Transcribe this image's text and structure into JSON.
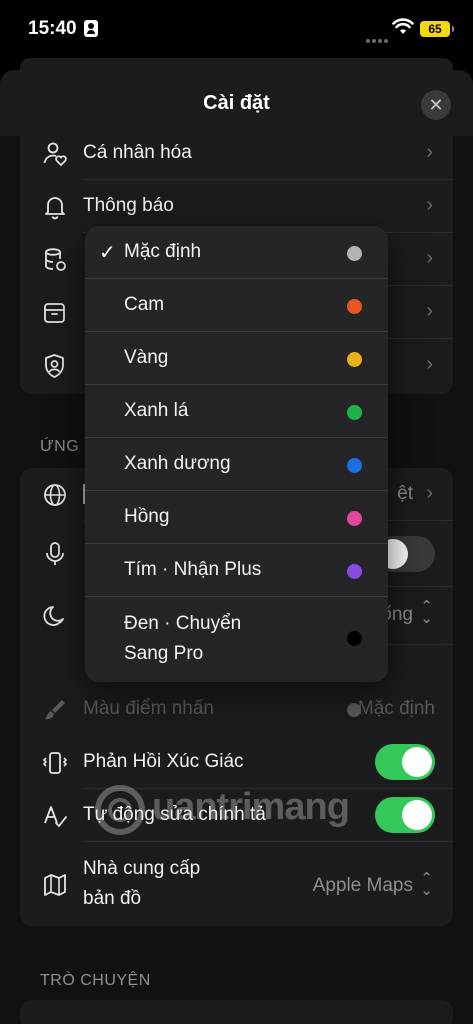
{
  "status_bar": {
    "time": "15:40",
    "battery": "65"
  },
  "sheet": {
    "title": "Cài đặt",
    "close_label": "✕"
  },
  "top_group": [
    {
      "label": "Cá nhân hóa",
      "icon": "person-heart-icon"
    },
    {
      "label": "Thông báo",
      "icon": "bell-icon"
    },
    {
      "label": "",
      "icon": "database-icon"
    },
    {
      "label": "",
      "icon": "archive-icon"
    },
    {
      "label": "",
      "icon": "shield-person-icon"
    }
  ],
  "section_app": {
    "header": "ỨNG"
  },
  "app_group": {
    "language": {
      "icon": "globe-icon",
      "value": "ệt"
    },
    "voice": {
      "icon": "microphone-icon"
    },
    "appearance": {
      "icon": "moon-icon",
      "value": "ống"
    },
    "accent_color": {
      "icon": "brush-icon",
      "label": "Màu điểm nhấn",
      "value": "Mặc định"
    },
    "haptic": {
      "icon": "haptic-icon",
      "label": "Phản Hồi Xúc Giác",
      "on": true
    },
    "autocorrect": {
      "icon": "autocorrect-icon",
      "label": "Tự động sửa chính tả",
      "on": true
    },
    "map_provider": {
      "icon": "map-icon",
      "label_line1": "Nhà cung cấp",
      "label_line2": "bản đồ",
      "value": "Apple Maps"
    }
  },
  "section_chat": {
    "header": "TRÒ CHUYỆN"
  },
  "color_menu": {
    "items": [
      {
        "label": "Mặc định",
        "color": "#b3b3b6",
        "selected": true
      },
      {
        "label": "Cam",
        "color": "#e8571e"
      },
      {
        "label": "Vàng",
        "color": "#e8b21a"
      },
      {
        "label": "Xanh lá",
        "color": "#1db34a"
      },
      {
        "label": "Xanh dương",
        "color": "#1c6fe0"
      },
      {
        "label": "Hồng",
        "color": "#e0489a"
      },
      {
        "label": "Tím · Nhận Plus",
        "color": "#8a4be0"
      },
      {
        "label_line1": "Đen · Chuyển",
        "label_line2": "Sang Pro",
        "color": "#000000"
      }
    ],
    "check_glyph": "✓"
  },
  "watermark": {
    "text": "uantrimang"
  }
}
